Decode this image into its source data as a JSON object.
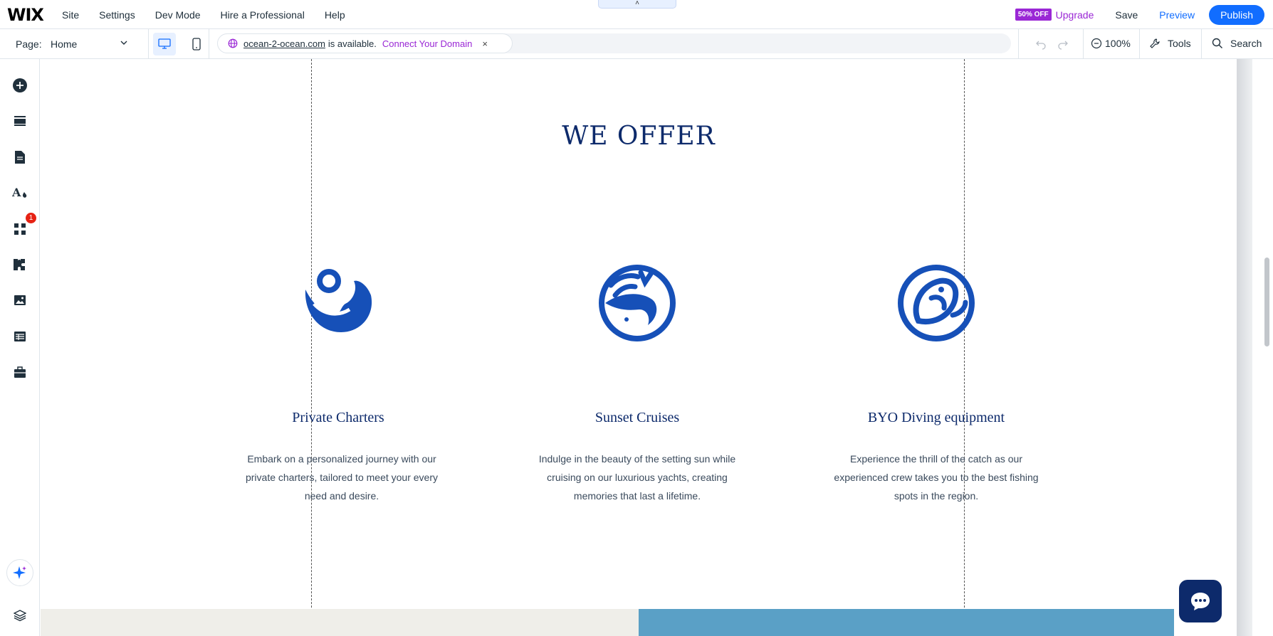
{
  "topbar": {
    "logo": "WIX",
    "menu": [
      "Site",
      "Settings",
      "Dev Mode",
      "Hire a Professional",
      "Help"
    ],
    "handle": "˄",
    "discount_badge": "50% OFF",
    "upgrade": "Upgrade",
    "save": "Save",
    "preview": "Preview",
    "publish": "Publish"
  },
  "secbar": {
    "page_label": "Page:",
    "page_value": "Home",
    "domain": "ocean-2-ocean.com",
    "available_text": "is available.",
    "connect": "Connect Your Domain",
    "close": "×",
    "zoom": "100%",
    "tools": "Tools",
    "search": "Search"
  },
  "leftrail": {
    "notification_count": "1"
  },
  "canvas": {
    "heading": "WE OFFER",
    "offers": [
      {
        "icon": "swimmer-wave-icon",
        "title": "Private Charters",
        "description": "Embark on a personalized journey with our private charters, tailored to meet your every need and desire."
      },
      {
        "icon": "whale-icon",
        "title": "Sunset Cruises",
        "description": "Indulge in the beauty of the setting sun while cruising on our luxurious yachts, creating memories that last a lifetime."
      },
      {
        "icon": "fish-icon",
        "title": "BYO Diving equipment",
        "description": "Experience the thrill of the catch as our experienced crew takes you to the best fishing spots in the region."
      }
    ]
  },
  "colors": {
    "accent": "#116dff",
    "upgrade": "#9a27d5",
    "brand_navy": "#0d2a6b",
    "icon_blue": "#1650b8"
  }
}
